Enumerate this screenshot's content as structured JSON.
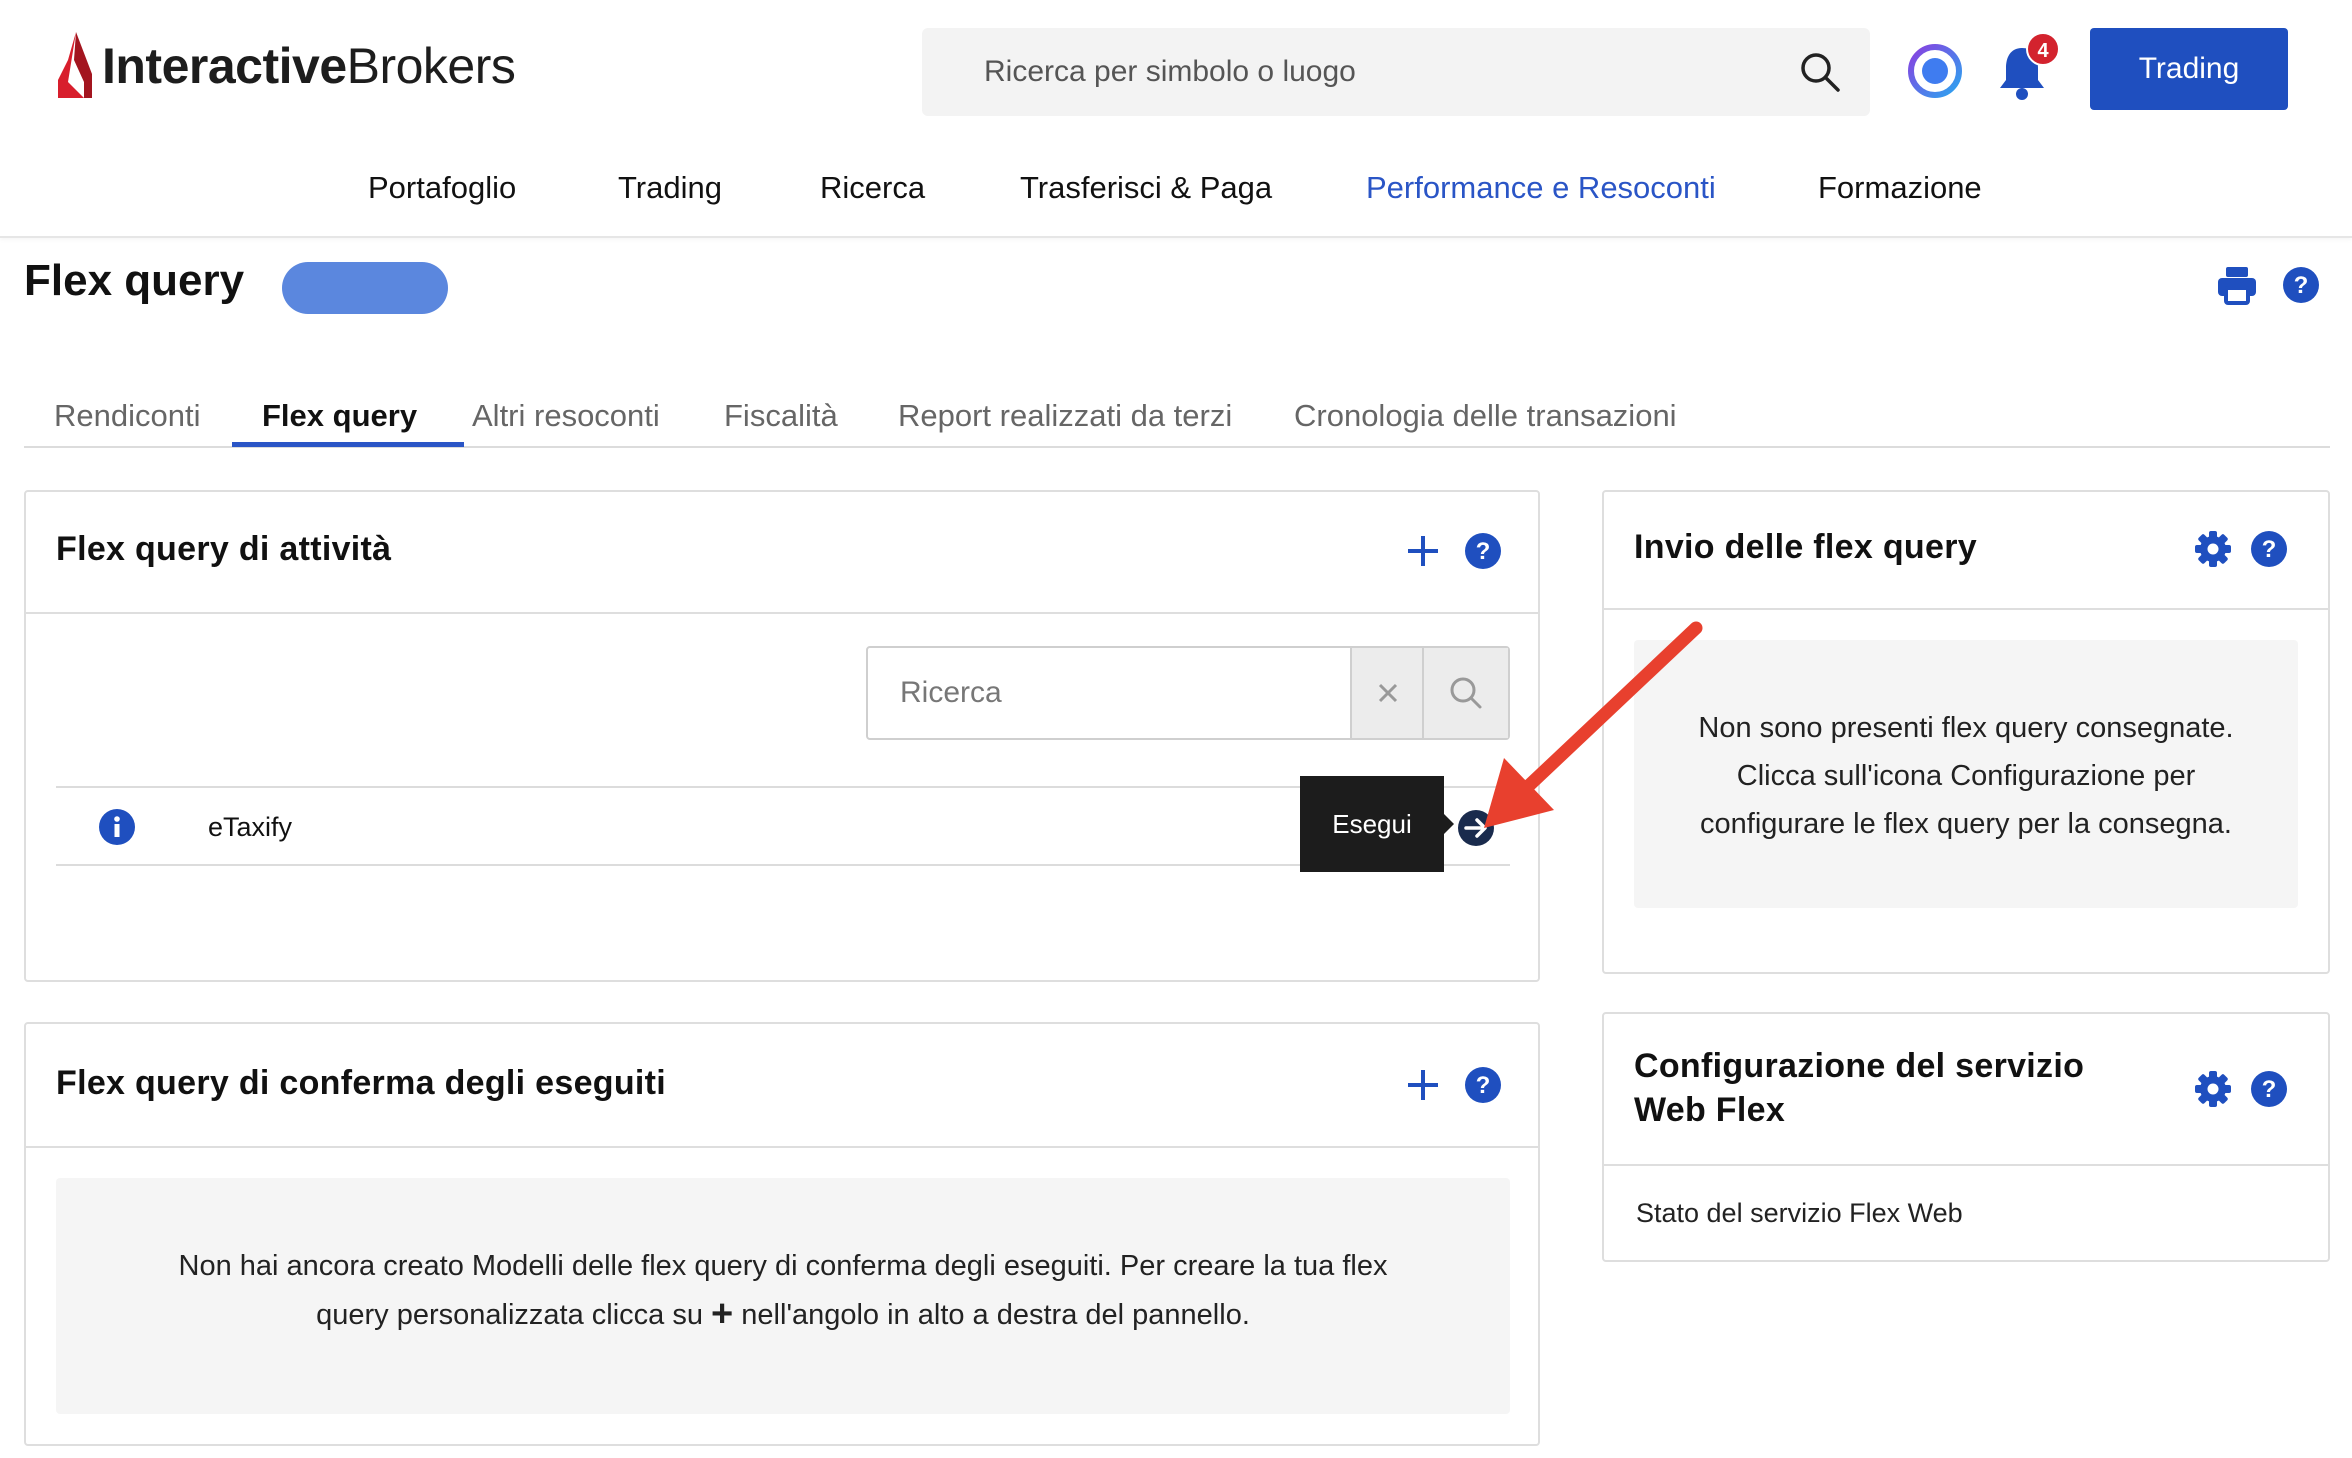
{
  "app": {
    "logo_bold": "Interactive",
    "logo_regular": "Brokers",
    "colors": {
      "brand_red": "#d81e2c",
      "accent_blue": "#1f4fbf",
      "link_blue": "#2a55c6",
      "badge_red": "#d3232e",
      "annotation_red": "#e8402e"
    }
  },
  "header": {
    "search_placeholder": "Ricerca per simbolo o luogo",
    "notification_count": "4",
    "trading_button": "Trading"
  },
  "nav": {
    "items": [
      {
        "label": "Portafoglio"
      },
      {
        "label": "Trading"
      },
      {
        "label": "Ricerca"
      },
      {
        "label": "Trasferisci & Paga"
      },
      {
        "label": "Performance e Resoconti",
        "active": true
      },
      {
        "label": "Formazione"
      }
    ]
  },
  "page": {
    "title": "Flex query"
  },
  "tabs": [
    {
      "label": "Rendiconti"
    },
    {
      "label": "Flex query",
      "active": true
    },
    {
      "label": "Altri resoconti"
    },
    {
      "label": "Fiscalità"
    },
    {
      "label": "Report realizzati da terzi"
    },
    {
      "label": "Cronologia delle transazioni"
    }
  ],
  "activity_panel": {
    "title": "Flex query di attività",
    "search_placeholder": "Ricerca",
    "rows": [
      {
        "name": "eTaxify"
      }
    ],
    "tooltip": "Esegui"
  },
  "confirm_panel": {
    "title": "Flex query di conferma degli eseguiti",
    "empty_line1": "Non hai ancora creato Modelli delle flex query di conferma degli eseguiti. Per creare la tua flex",
    "empty_line2_before": "query personalizzata clicca su",
    "empty_line2_plus": "+",
    "empty_line2_after": "nell'angolo in alto a destra del pannello."
  },
  "delivery_panel": {
    "title": "Invio delle flex query",
    "empty_line1": "Non sono presenti flex query consegnate.",
    "empty_line2": "Clicca sull'icona Configurazione per",
    "empty_line3": "configurare le flex query per la consegna."
  },
  "webflex_panel": {
    "title_line1": "Configurazione del servizio",
    "title_line2": "Web Flex",
    "status_label": "Stato del servizio Flex Web"
  }
}
